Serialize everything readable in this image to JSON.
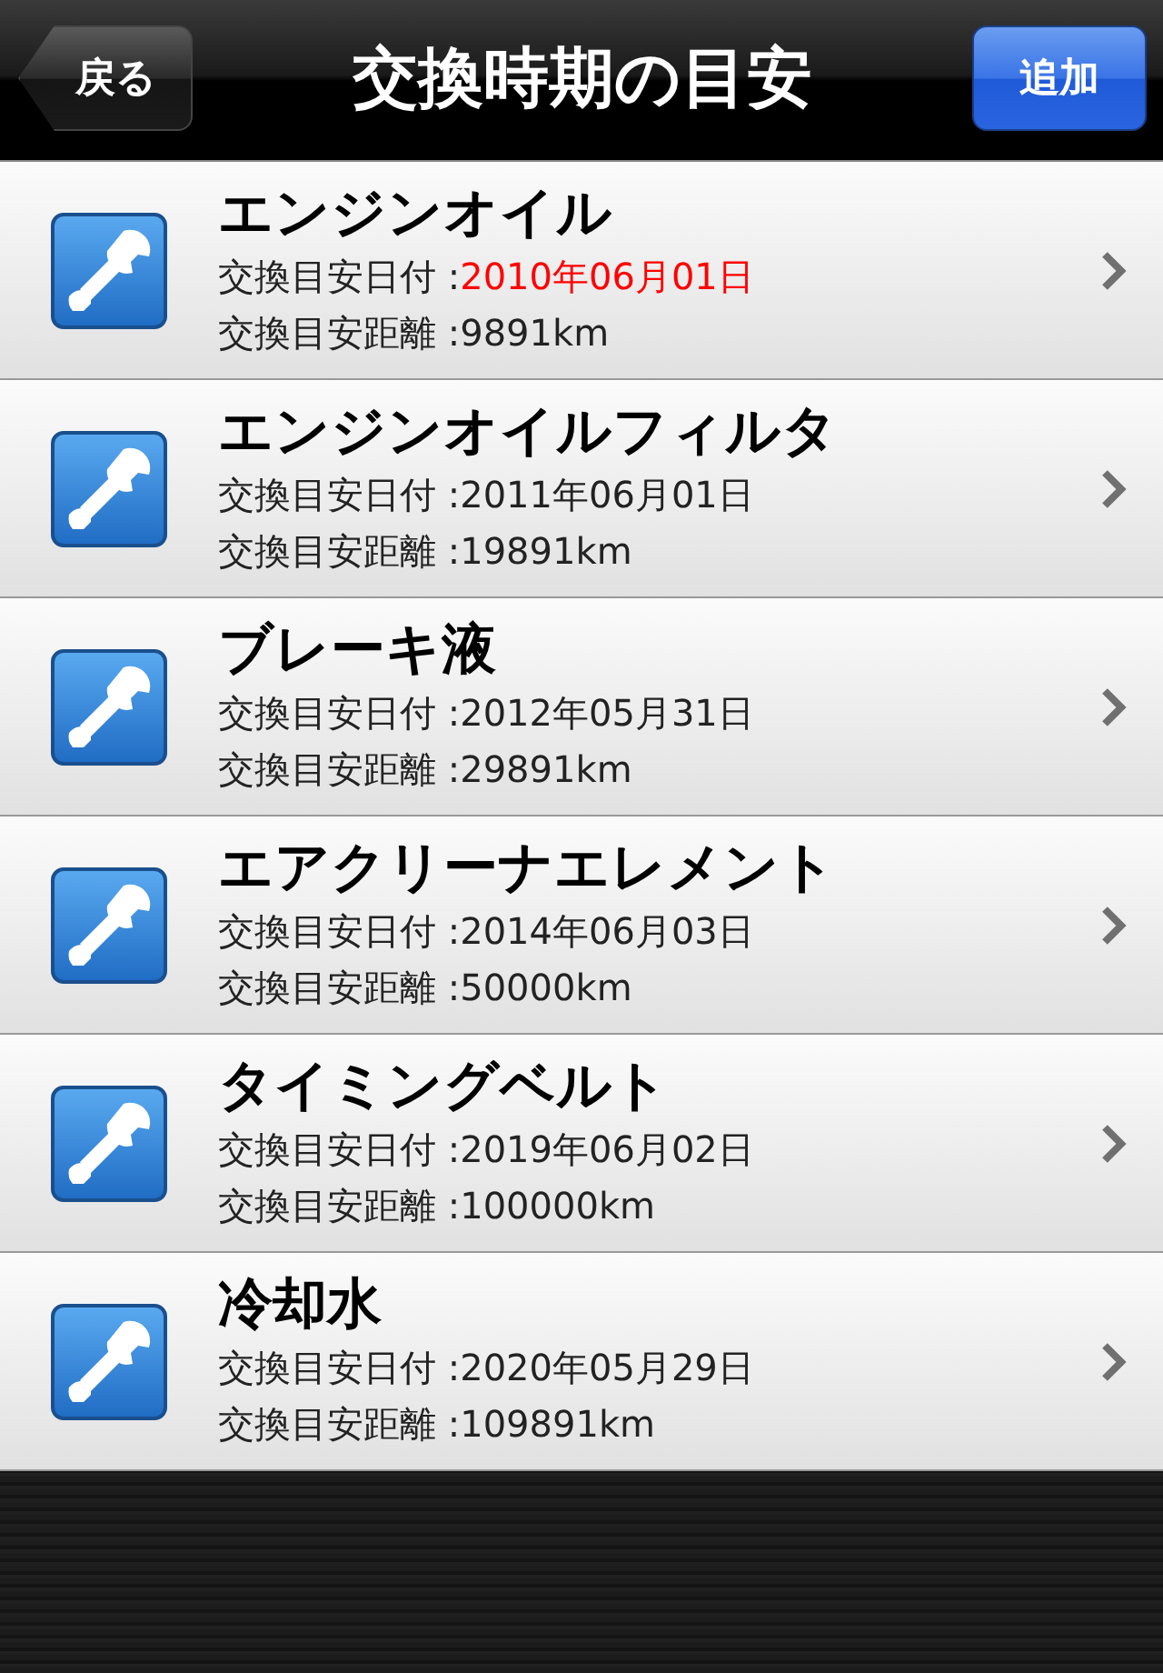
{
  "nav_bar": {
    "back_button": "戻る",
    "title": "交換時期の目安",
    "add_button": "追加"
  },
  "items": [
    {
      "name": "エンジンオイル",
      "date_label": "交換目安日付 :",
      "date": "2010年06月01日",
      "overdue": true,
      "distance_label": "交換目安距離 :",
      "distance": "9891km"
    },
    {
      "name": "エンジンオイルフィルタ",
      "date_label": "交換目安日付 :",
      "date": "2011年06月01日",
      "overdue": false,
      "distance_label": "交換目安距離 :",
      "distance": "19891km"
    },
    {
      "name": "ブレーキ液",
      "date_label": "交換目安日付 :",
      "date": "2012年05月31日",
      "overdue": false,
      "distance_label": "交換目安距離 :",
      "distance": "29891km"
    },
    {
      "name": "エアクリーナエレメント",
      "date_label": "交換目安日付 :",
      "date": "2014年06月03日",
      "overdue": false,
      "distance_label": "交換目安距離 :",
      "distance": "50000km"
    },
    {
      "name": "タイミングベルト",
      "date_label": "交換目安日付 :",
      "date": "2019年06月02日",
      "overdue": false,
      "distance_label": "交換目安距離 :",
      "distance": "100000km"
    },
    {
      "name": "冷却水",
      "date_label": "交換目安日付 :",
      "date": "2020年05月29日",
      "overdue": false,
      "distance_label": "交換目安距離 :",
      "distance": "109891km"
    }
  ]
}
